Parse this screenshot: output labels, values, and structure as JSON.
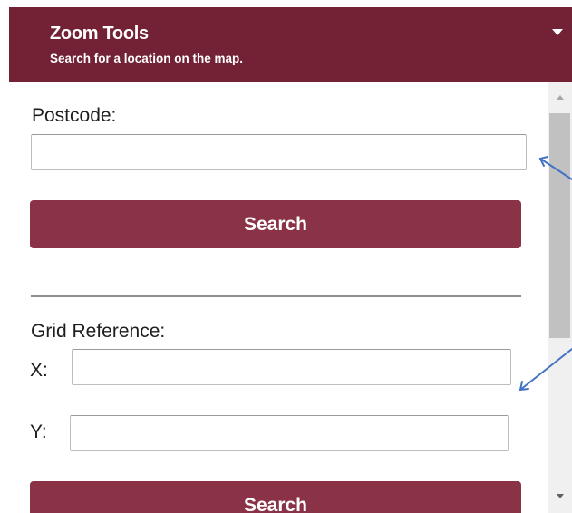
{
  "header": {
    "title": "Zoom Tools",
    "subtitle": "Search for a location on the map.",
    "background_color": "#722234",
    "caret_icon": "caret-down-icon"
  },
  "postcode": {
    "label": "Postcode:",
    "value": "",
    "search_label": "Search"
  },
  "grid_reference": {
    "label": "Grid Reference:",
    "x_label": "X:",
    "x_value": "",
    "y_label": "Y:",
    "y_value": "",
    "search_label": "Search"
  },
  "colors": {
    "button": "#8a3347",
    "annotation_arrow": "#4472c4"
  }
}
